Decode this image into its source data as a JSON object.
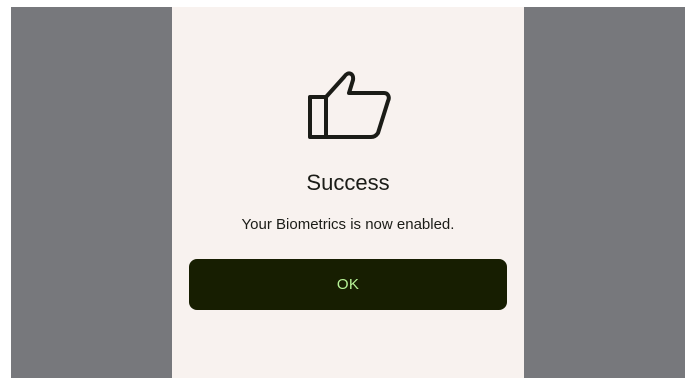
{
  "dialog": {
    "icon": "thumbs-up-icon",
    "title": "Success",
    "message": "Your Biometrics is now enabled.",
    "ok_label": "OK"
  },
  "colors": {
    "backdrop": "#77787c",
    "dialog_bg": "#f8f2ef",
    "text": "#1b1c17",
    "button_bg": "#171e01",
    "button_text": "#b7f397",
    "icon_stroke": "#1b1c17"
  }
}
